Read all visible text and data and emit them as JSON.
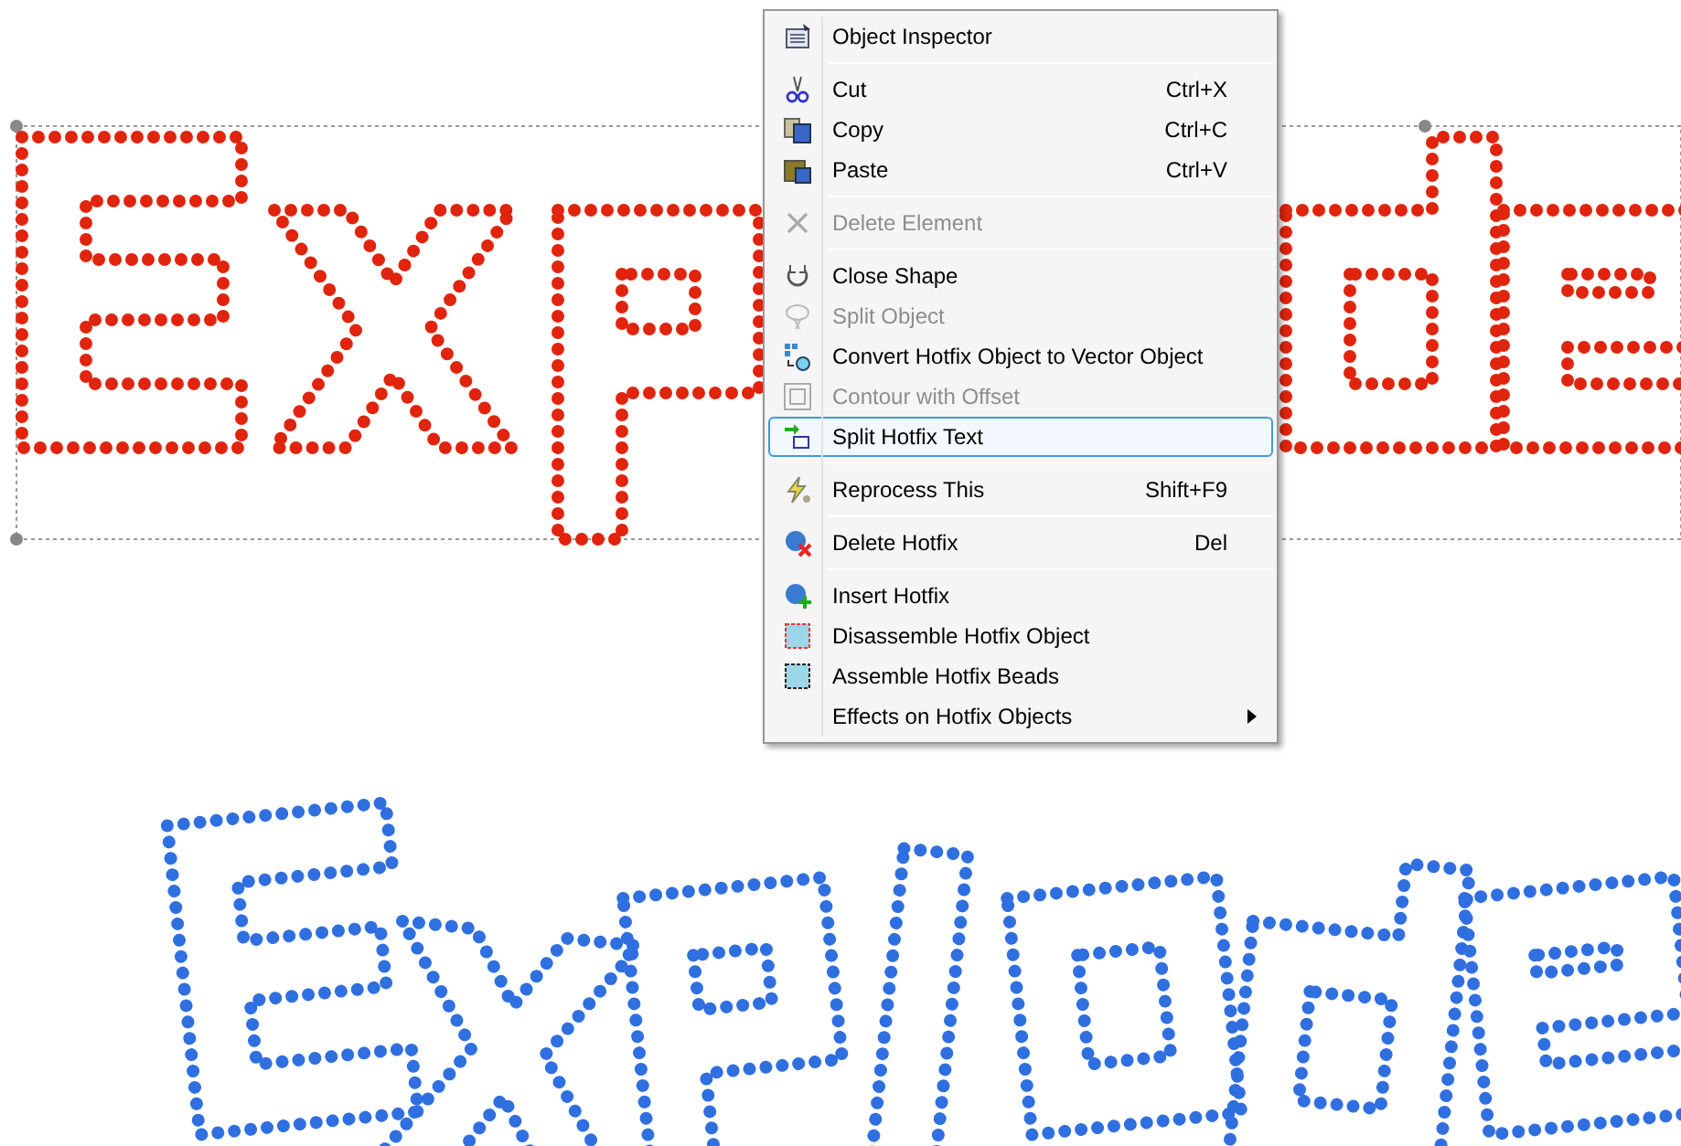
{
  "canvas": {
    "selected_artwork": {
      "selected": true
    }
  },
  "context_menu": {
    "items": [
      {
        "kind": "item",
        "label": "Object Inspector",
        "disabled": false,
        "selected": false
      },
      {
        "kind": "separator"
      },
      {
        "kind": "item",
        "label": "Cut",
        "shortcut": "Ctrl+X",
        "disabled": false,
        "selected": false
      },
      {
        "kind": "item",
        "label": "Copy",
        "shortcut": "Ctrl+C",
        "disabled": false,
        "selected": false
      },
      {
        "kind": "item",
        "label": "Paste",
        "shortcut": "Ctrl+V",
        "disabled": false,
        "selected": false
      },
      {
        "kind": "separator"
      },
      {
        "kind": "item",
        "label": "Delete Element",
        "disabled": true,
        "selected": false
      },
      {
        "kind": "separator"
      },
      {
        "kind": "item",
        "label": "Close Shape",
        "disabled": false,
        "selected": false
      },
      {
        "kind": "item",
        "label": "Split Object",
        "disabled": true,
        "selected": false
      },
      {
        "kind": "item",
        "label": "Convert Hotfix Object to Vector Object",
        "disabled": false,
        "selected": false
      },
      {
        "kind": "item",
        "label": "Contour with Offset",
        "disabled": true,
        "selected": false
      },
      {
        "kind": "item",
        "label": "Split Hotfix Text",
        "disabled": false,
        "selected": true
      },
      {
        "kind": "separator"
      },
      {
        "kind": "item",
        "label": "Reprocess This",
        "shortcut": "Shift+F9",
        "disabled": false,
        "selected": false
      },
      {
        "kind": "separator"
      },
      {
        "kind": "item",
        "label": "Delete Hotfix",
        "shortcut": "Del",
        "disabled": false,
        "selected": false
      },
      {
        "kind": "separator"
      },
      {
        "kind": "item",
        "label": "Insert Hotfix",
        "disabled": false,
        "selected": false
      },
      {
        "kind": "item",
        "label": "Disassemble Hotfix Object",
        "disabled": false,
        "selected": false
      },
      {
        "kind": "item",
        "label": "Assemble Hotfix Beads",
        "disabled": false,
        "selected": false
      },
      {
        "kind": "item",
        "label": "Effects on Hotfix Objects",
        "disabled": false,
        "selected": false,
        "submenu": true
      }
    ]
  }
}
